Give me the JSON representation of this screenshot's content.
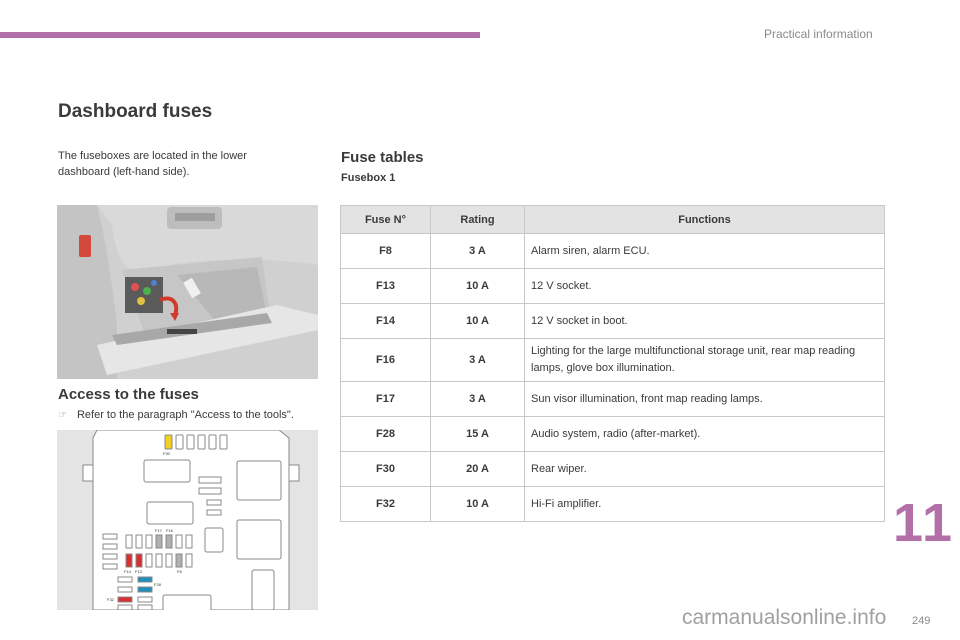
{
  "header": {
    "section_label": "Practical information",
    "accent_color": "#b36fa8"
  },
  "main": {
    "title": "Dashboard fuses",
    "intro": "The fuseboxes are located in the lower dashboard (left-hand side).",
    "access": {
      "heading": "Access to the fuses",
      "bullet_icon": "pointing-hand-icon",
      "bullet_text": "Refer to the paragraph \"Access to the tools\"."
    },
    "photo_alt": "Glove box open showing fusebox access with arrow",
    "diagram": {
      "labels": [
        "F30",
        "F17",
        "F16",
        "F14",
        "F13",
        "F8",
        "F28",
        "F32"
      ],
      "colors": {
        "yellow": "#f0d020",
        "red": "#d83030",
        "blue": "#1e8fb8",
        "grey": "#b0b0b0"
      }
    }
  },
  "fuse_tables": {
    "heading": "Fuse tables",
    "subheading": "Fusebox 1",
    "columns": [
      "Fuse N°",
      "Rating",
      "Functions"
    ],
    "rows": [
      {
        "fuse": "F8",
        "rating": "3 A",
        "function": "Alarm siren, alarm ECU."
      },
      {
        "fuse": "F13",
        "rating": "10 A",
        "function": "12 V socket."
      },
      {
        "fuse": "F14",
        "rating": "10 A",
        "function": "12 V socket in boot."
      },
      {
        "fuse": "F16",
        "rating": "3 A",
        "function": "Lighting for the large multifunctional storage unit, rear map reading lamps, glove box illumination."
      },
      {
        "fuse": "F17",
        "rating": "3 A",
        "function": "Sun visor illumination, front map reading lamps."
      },
      {
        "fuse": "F28",
        "rating": "15 A",
        "function": "Audio system, radio (after-market)."
      },
      {
        "fuse": "F30",
        "rating": "20 A",
        "function": "Rear wiper."
      },
      {
        "fuse": "F32",
        "rating": "10 A",
        "function": "Hi-Fi amplifier."
      }
    ]
  },
  "footer": {
    "chapter": "11",
    "page_number": "249",
    "watermark": "carmanualsonline.info"
  }
}
